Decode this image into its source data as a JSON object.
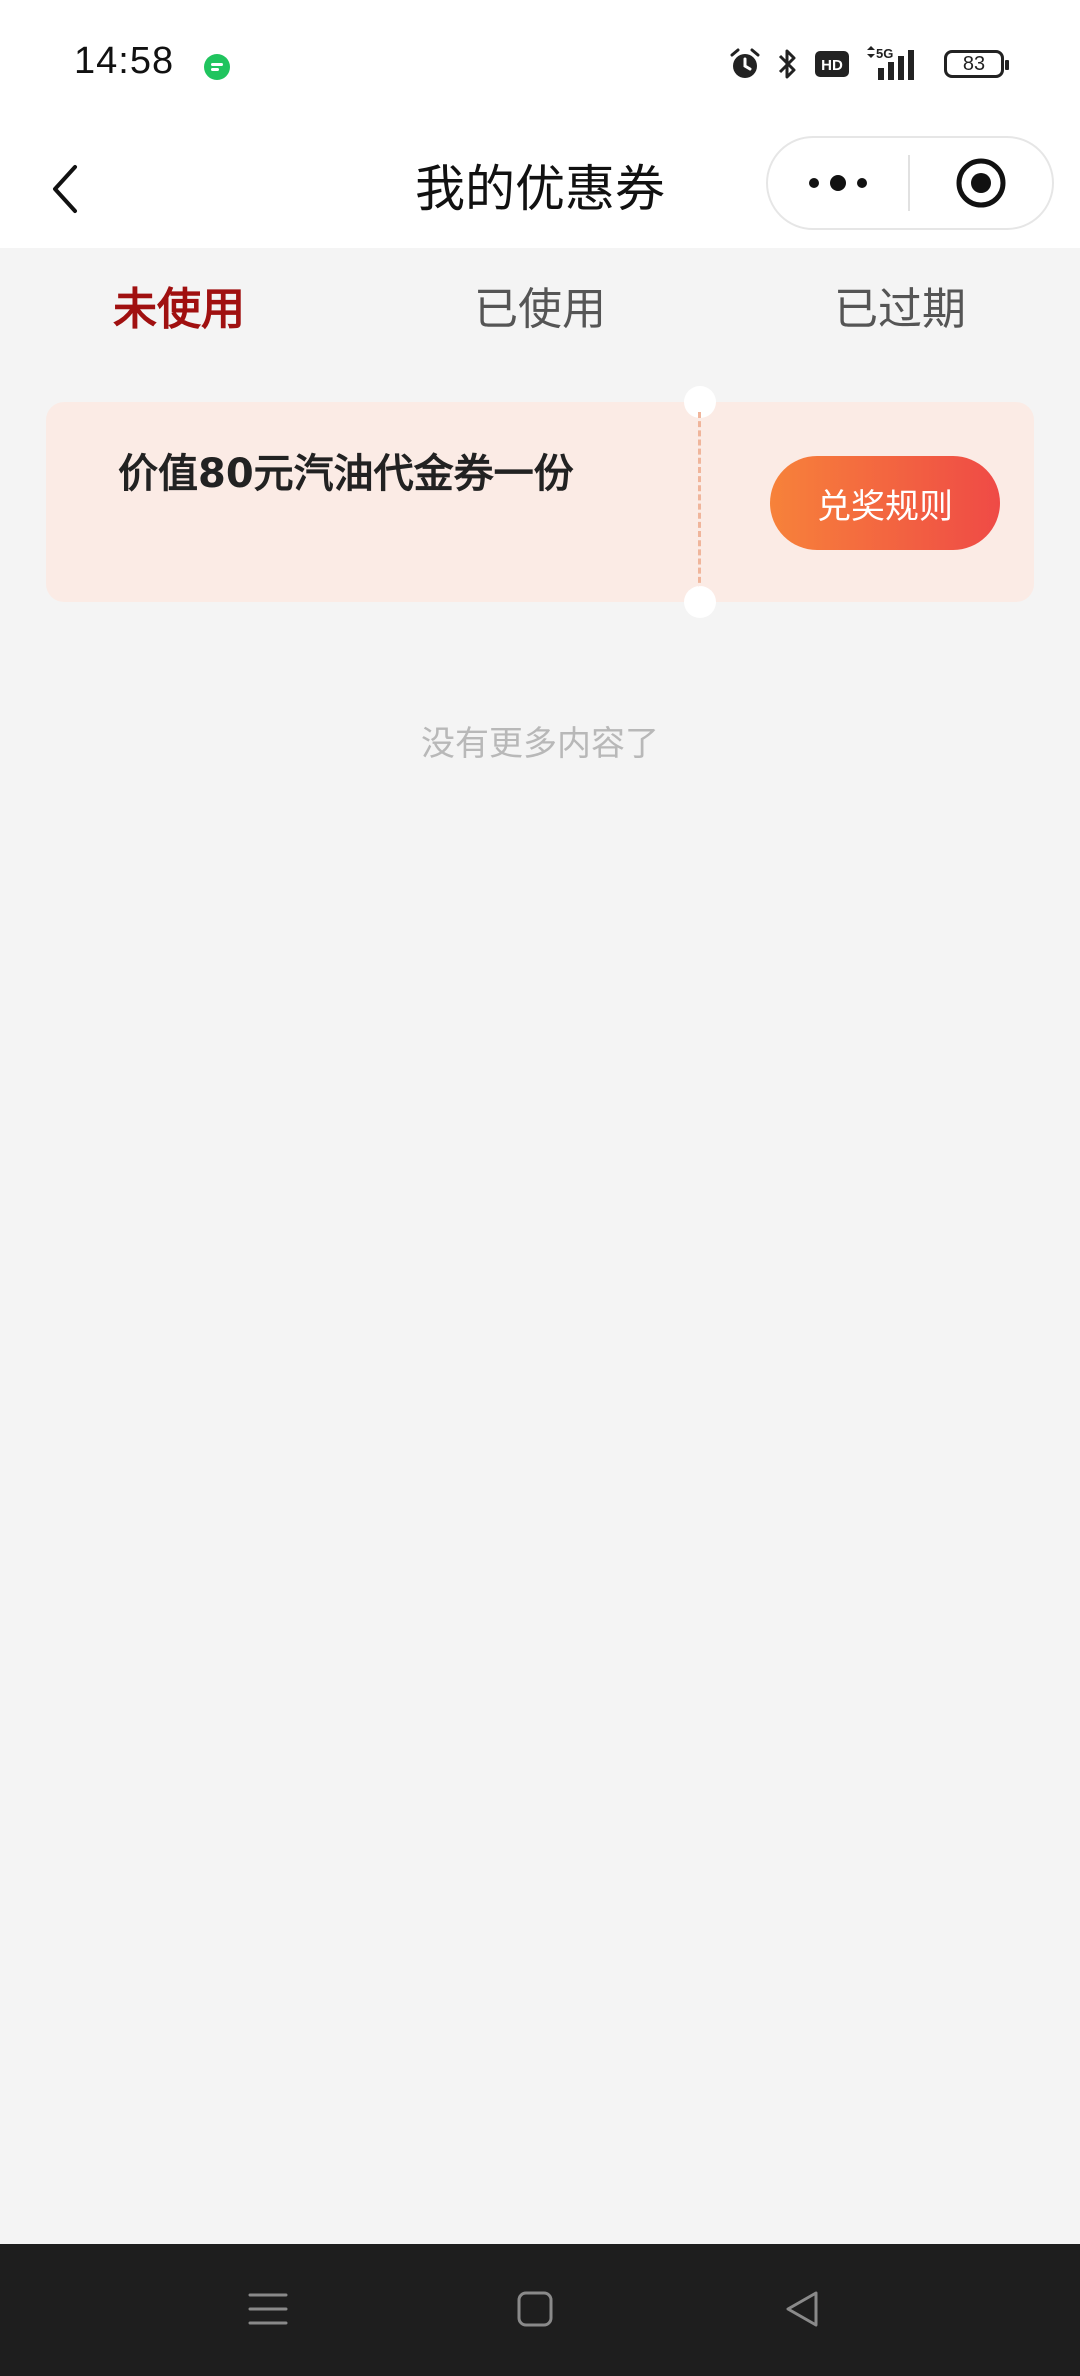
{
  "status_bar": {
    "time": "14:58",
    "battery": "83",
    "icons": [
      "chat-notification-icon",
      "alarm-icon",
      "bluetooth-icon",
      "hd-icon",
      "5g-signal-icon",
      "battery-icon"
    ]
  },
  "nav": {
    "title": "我的优惠券",
    "back_icon": "back-arrow-icon",
    "more_icon": "more-dots-icon",
    "close_icon": "target-close-icon"
  },
  "tabs": [
    {
      "label": "未使用",
      "active": true
    },
    {
      "label": "已使用",
      "active": false
    },
    {
      "label": "已过期",
      "active": false
    }
  ],
  "coupons": [
    {
      "title": "价值80元汽油代金券一份",
      "button": "兑奖规则"
    }
  ],
  "empty_text": "没有更多内容了",
  "colors": {
    "active_tab": "#a01010",
    "coupon_bg": "#fbebe5",
    "button_gradient_start": "#f7823a",
    "button_gradient_end": "#ef4a46"
  },
  "system_nav": [
    "menu-icon",
    "home-square-icon",
    "back-triangle-icon"
  ]
}
